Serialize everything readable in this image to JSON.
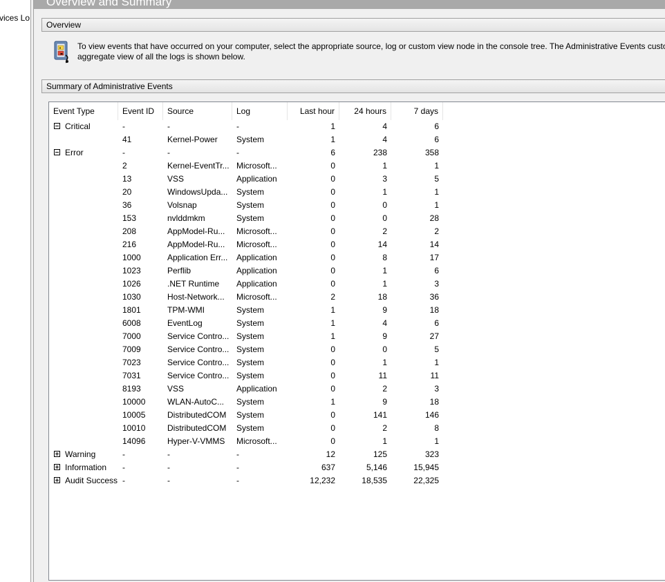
{
  "left_pane": {
    "visible_text": "rvices Lo"
  },
  "header": {
    "title": "Overview and Summary"
  },
  "overview": {
    "label": "Overview",
    "icon": "event-viewer-icon",
    "text_line1": "To view events that have occurred on your computer, select the appropriate source, log or custom view node in the console tree. The Administrative Events custo",
    "text_line2": "aggregate view of all the logs is shown below."
  },
  "summary": {
    "label": "Summary of Administrative Events",
    "columns": [
      "Event Type",
      "Event ID",
      "Source",
      "Log",
      "Last hour",
      "24 hours",
      "7 days"
    ],
    "rows": [
      {
        "type": "Critical",
        "expander": "minus",
        "id": "-",
        "source": "-",
        "log": "-",
        "hour": "1",
        "day": "4",
        "week": "6"
      },
      {
        "type": "",
        "id": "41",
        "source": "Kernel-Power",
        "log": "System",
        "hour": "1",
        "day": "4",
        "week": "6"
      },
      {
        "type": "Error",
        "expander": "minus",
        "id": "-",
        "source": "-",
        "log": "-",
        "hour": "6",
        "day": "238",
        "week": "358"
      },
      {
        "type": "",
        "id": "2",
        "source": "Kernel-EventTr...",
        "log": "Microsoft...",
        "hour": "0",
        "day": "1",
        "week": "1"
      },
      {
        "type": "",
        "id": "13",
        "source": "VSS",
        "log": "Application",
        "hour": "0",
        "day": "3",
        "week": "5"
      },
      {
        "type": "",
        "id": "20",
        "source": "WindowsUpda...",
        "log": "System",
        "hour": "0",
        "day": "1",
        "week": "1"
      },
      {
        "type": "",
        "id": "36",
        "source": "Volsnap",
        "log": "System",
        "hour": "0",
        "day": "0",
        "week": "1"
      },
      {
        "type": "",
        "id": "153",
        "source": "nvlddmkm",
        "log": "System",
        "hour": "0",
        "day": "0",
        "week": "28"
      },
      {
        "type": "",
        "id": "208",
        "source": "AppModel-Ru...",
        "log": "Microsoft...",
        "hour": "0",
        "day": "2",
        "week": "2"
      },
      {
        "type": "",
        "id": "216",
        "source": "AppModel-Ru...",
        "log": "Microsoft...",
        "hour": "0",
        "day": "14",
        "week": "14"
      },
      {
        "type": "",
        "id": "1000",
        "source": "Application Err...",
        "log": "Application",
        "hour": "0",
        "day": "8",
        "week": "17"
      },
      {
        "type": "",
        "id": "1023",
        "source": "Perflib",
        "log": "Application",
        "hour": "0",
        "day": "1",
        "week": "6"
      },
      {
        "type": "",
        "id": "1026",
        "source": ".NET Runtime",
        "log": "Application",
        "hour": "0",
        "day": "1",
        "week": "3"
      },
      {
        "type": "",
        "id": "1030",
        "source": "Host-Network...",
        "log": "Microsoft...",
        "hour": "2",
        "day": "18",
        "week": "36"
      },
      {
        "type": "",
        "id": "1801",
        "source": "TPM-WMI",
        "log": "System",
        "hour": "1",
        "day": "9",
        "week": "18"
      },
      {
        "type": "",
        "id": "6008",
        "source": "EventLog",
        "log": "System",
        "hour": "1",
        "day": "4",
        "week": "6"
      },
      {
        "type": "",
        "id": "7000",
        "source": "Service Contro...",
        "log": "System",
        "hour": "1",
        "day": "9",
        "week": "27"
      },
      {
        "type": "",
        "id": "7009",
        "source": "Service Contro...",
        "log": "System",
        "hour": "0",
        "day": "0",
        "week": "5"
      },
      {
        "type": "",
        "id": "7023",
        "source": "Service Contro...",
        "log": "System",
        "hour": "0",
        "day": "1",
        "week": "1"
      },
      {
        "type": "",
        "id": "7031",
        "source": "Service Contro...",
        "log": "System",
        "hour": "0",
        "day": "11",
        "week": "11"
      },
      {
        "type": "",
        "id": "8193",
        "source": "VSS",
        "log": "Application",
        "hour": "0",
        "day": "2",
        "week": "3"
      },
      {
        "type": "",
        "id": "10000",
        "source": "WLAN-AutoC...",
        "log": "System",
        "hour": "1",
        "day": "9",
        "week": "18"
      },
      {
        "type": "",
        "id": "10005",
        "source": "DistributedCOM",
        "log": "System",
        "hour": "0",
        "day": "141",
        "week": "146"
      },
      {
        "type": "",
        "id": "10010",
        "source": "DistributedCOM",
        "log": "System",
        "hour": "0",
        "day": "2",
        "week": "8"
      },
      {
        "type": "",
        "id": "14096",
        "source": "Hyper-V-VMMS",
        "log": "Microsoft...",
        "hour": "0",
        "day": "1",
        "week": "1"
      },
      {
        "type": "Warning",
        "expander": "plus",
        "id": "-",
        "source": "-",
        "log": "-",
        "hour": "12",
        "day": "125",
        "week": "323"
      },
      {
        "type": "Information",
        "expander": "plus",
        "id": "-",
        "source": "-",
        "log": "-",
        "hour": "637",
        "day": "5,146",
        "week": "15,945"
      },
      {
        "type": "Audit Success",
        "expander": "plus",
        "id": "-",
        "source": "-",
        "log": "-",
        "hour": "12,232",
        "day": "18,535",
        "week": "22,325"
      }
    ]
  }
}
